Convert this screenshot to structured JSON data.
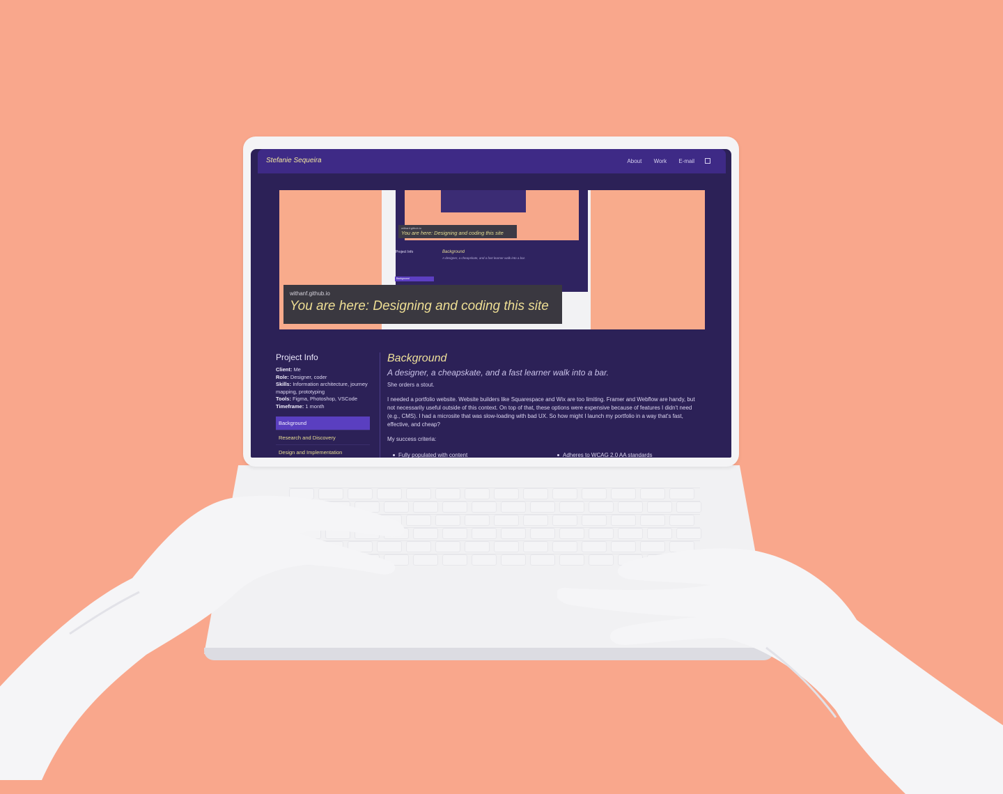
{
  "site": {
    "brand": "Stefanie Sequeira",
    "nav": [
      {
        "label": "About"
      },
      {
        "label": "Work"
      },
      {
        "label": "E-mail"
      }
    ]
  },
  "hero": {
    "caption_url": "withanf.github.io",
    "caption_title": "You are here: Designing and coding this site",
    "mini_caption_url": "withanf.github.io",
    "mini_caption_title": "You are here: Designing and coding this site",
    "mini_project_info": "Project Info",
    "mini_background": "Background",
    "mini_subheading": "A designer, a cheapskate, and a fast learner walk into a bar.",
    "mini_background_btn": "Background"
  },
  "sidebar": {
    "title": "Project Info",
    "info": [
      {
        "label": "Client:",
        "value": "Me"
      },
      {
        "label": "Role:",
        "value": "Designer, coder"
      },
      {
        "label": "Skills:",
        "value": "Information architecture, journey mapping, prototyping"
      },
      {
        "label": "Tools:",
        "value": "Figma, Photoshop, VSCode"
      },
      {
        "label": "Timeframe:",
        "value": "1 month"
      }
    ],
    "toc": [
      {
        "label": "Background",
        "active": true
      },
      {
        "label": "Research and Discovery",
        "active": false
      },
      {
        "label": "Design and Implementation",
        "active": false
      }
    ]
  },
  "content": {
    "heading": "Background",
    "subheading": "A designer, a cheapskate, and a fast learner walk into a bar.",
    "small": "She orders a stout.",
    "paragraph": "I needed a portfolio website. Website builders like Squarespace and Wix are too limiting. Framer and Webflow are handy, but not necessarily useful outside of this context. On top of that, these options were expensive because of features I didn't need (e.g., CMS). I had a microsite that was slow-loading with bad UX. So how might I launch my portfolio in a way that's fast, effective, and cheap?",
    "criteria_intro": "My success criteria:",
    "criteria": [
      {
        "label": "Fully populated with content"
      },
      {
        "label": "Adheres to WCAG 2.0 AA standards"
      }
    ]
  },
  "colors": {
    "background": "#f9a78c",
    "screen": "#2c2157",
    "navbar": "#3e2a86",
    "accent_yellow": "#eede94",
    "active_item": "#5a3fc0"
  }
}
